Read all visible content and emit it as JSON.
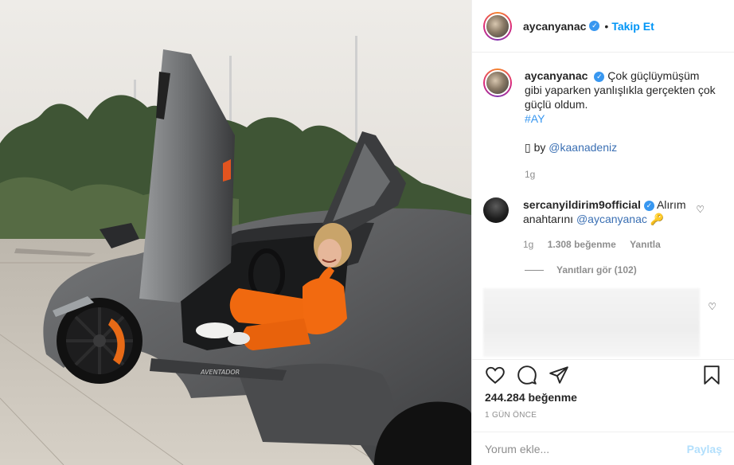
{
  "header": {
    "username": "aycanyanac",
    "separator": "•",
    "follow_label": "Takip Et"
  },
  "caption": {
    "username": "aycanyanac",
    "text": "Çok güçlüymüşüm gibi yaparken yanlışlıkla gerçekten çok güçlü oldum.",
    "hashtag": "#AY",
    "credit_prefix": "▯ by",
    "credit_mention": "@kaanadeniz",
    "time": "1g"
  },
  "comment": {
    "username": "sercanyildirim9official",
    "text_prefix": "Alırım anahtarını",
    "mention": "@aycanyanac",
    "emoji": "🔑",
    "time": "1g",
    "likes": "1.308 beğenme",
    "reply_label": "Yanıtla",
    "view_replies": "Yanıtları gör (102)"
  },
  "actions": {
    "likes": "244.284 beğenme",
    "posted_ago": "1 GÜN ÖNCE"
  },
  "comment_box": {
    "placeholder": "Yorum ekle...",
    "post_label": "Paylaş"
  },
  "colors": {
    "accent": "#0095f6",
    "verified": "#3897f0",
    "car_body": "#5f6062",
    "outfit": "#f26a10"
  },
  "icons": {
    "like": "heart-icon",
    "comment": "comment-icon",
    "share": "paper-plane-icon",
    "save": "bookmark-icon"
  }
}
